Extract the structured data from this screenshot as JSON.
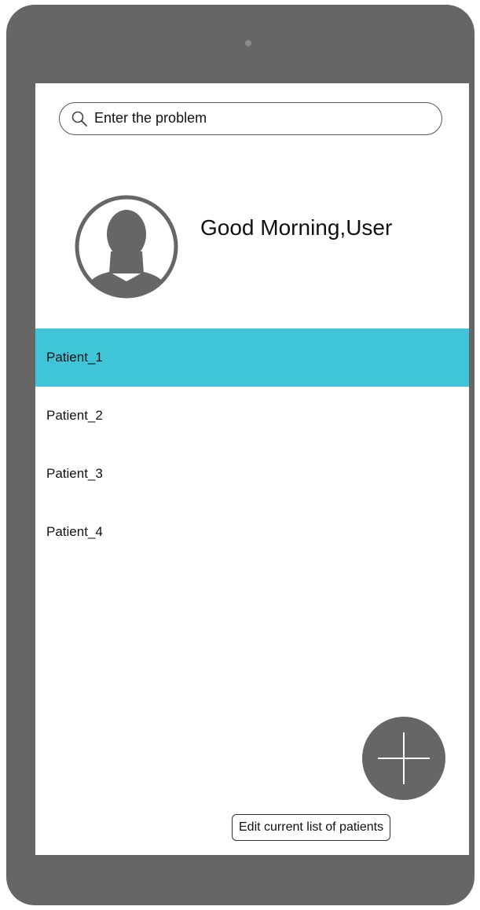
{
  "colors": {
    "device_frame": "#666666",
    "screen_background": "#ffffff",
    "selected_row": "#40c4d8",
    "fab_background": "#666666"
  },
  "search": {
    "placeholder": "Enter the problem",
    "icon": "search-icon"
  },
  "header": {
    "avatar_icon": "user-avatar-icon",
    "greeting": "Good Morning,User"
  },
  "patients": {
    "selected_index": 0,
    "items": [
      {
        "label": "Patient_1"
      },
      {
        "label": "Patient_2"
      },
      {
        "label": "Patient_3"
      },
      {
        "label": "Patient_4"
      }
    ]
  },
  "actions": {
    "add_icon": "plus-icon",
    "edit_label": "Edit current list of patients"
  }
}
